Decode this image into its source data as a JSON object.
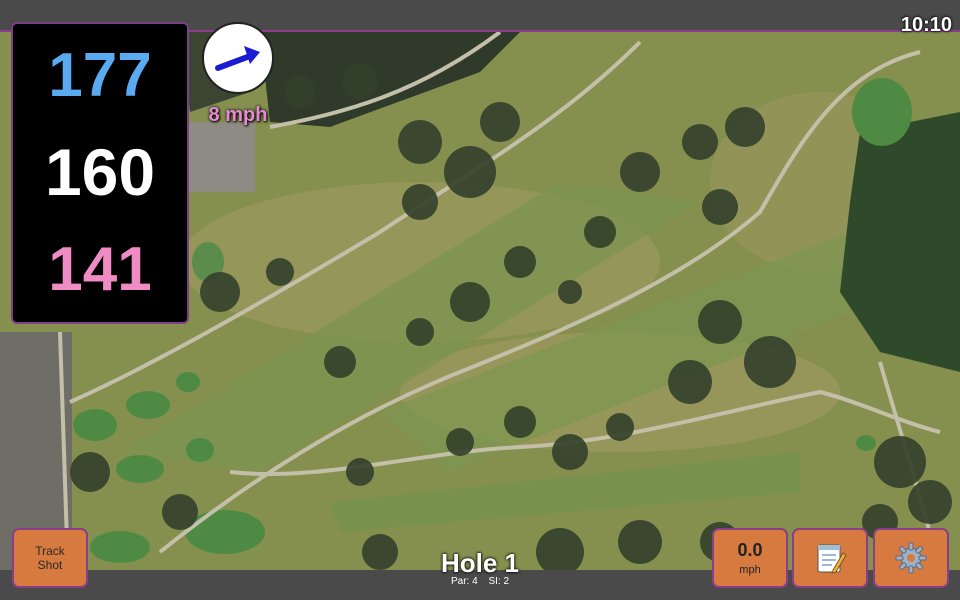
{
  "status": {
    "time": "10:10"
  },
  "yardages": {
    "back": "177",
    "middle": "160",
    "front": "141"
  },
  "wind": {
    "speed_label": "8 mph",
    "direction_icon": "arrow-right-icon"
  },
  "controls": {
    "track_shot": {
      "line1": "Track",
      "line2": "Shot"
    },
    "speed": {
      "value": "0.0",
      "unit": "mph"
    },
    "notes_icon": "notepad-icon",
    "settings_icon": "gear-icon"
  },
  "hole": {
    "title": "Hole 1",
    "par": "Par: 4",
    "si": "SI: 2"
  },
  "colors": {
    "back_yardage": "#5aaaf2",
    "middle_yardage": "#ffffff",
    "front_yardage": "#ef8cc4",
    "button_fill": "#d67a3f",
    "accent_border": "#8a3e8a"
  }
}
